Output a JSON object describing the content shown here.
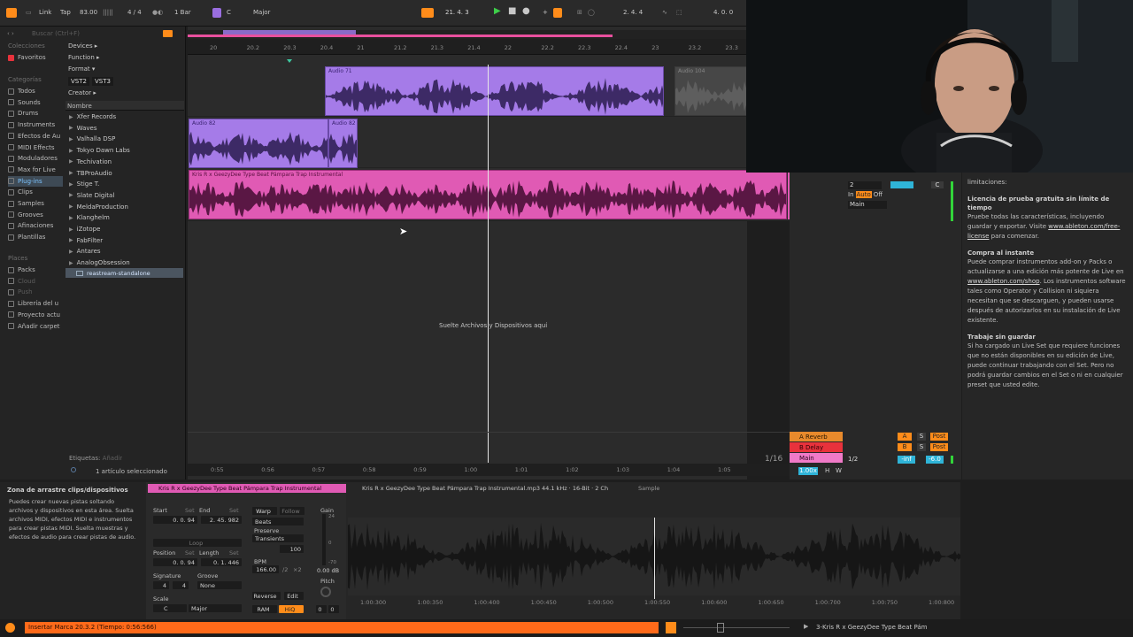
{
  "topbar": {
    "link": "Link",
    "tap": "Tap",
    "tempo": "83.00",
    "signature": "4 / 4",
    "quantize": "1 Bar",
    "key": "C",
    "scale": "Major",
    "position": "21.   4.   3",
    "loop_start": "2.   4.   4",
    "loop_end": "4.   0.   0"
  },
  "browser": {
    "search_placeholder": "Buscar (Ctrl+F)",
    "collections_header": "Colecciones",
    "favorites": "Favoritos",
    "categories_header": "Categorías",
    "categories": [
      "Todos",
      "Sounds",
      "Drums",
      "Instruments",
      "Efectos de Au",
      "MIDI Effects",
      "Moduladores",
      "Max for Live",
      "Plug-ins",
      "Clips",
      "Samples",
      "Grooves",
      "Afinaciones",
      "Plantillas"
    ],
    "places_header": "Places",
    "places": [
      "Packs",
      "Cloud",
      "Push",
      "Librería del u",
      "Proyecto actu",
      "Añadir carpet"
    ],
    "filters": [
      "Devices ▸",
      "Function ▸",
      "Format ▾",
      "Creator ▸"
    ],
    "formats": [
      "VST2",
      "VST3"
    ],
    "column_name": "Nombre",
    "plugins": [
      "Xfer Records",
      "Waves",
      "Valhalla DSP",
      "Tokyo Dawn Labs",
      "Techivation",
      "TBProAudio",
      "Stige T.",
      "Slate Digital",
      "MeldaProduction",
      "Klanghelm",
      "iZotope",
      "FabFilter",
      "Antares",
      "AnalogObsession"
    ],
    "selected_plugin": "reastream-standalone",
    "tags_label": "Etiquetas:",
    "tags_value": "Añadir",
    "selection_count": "1 artículo seleccionado"
  },
  "arrangement": {
    "ruler": [
      "20",
      "20.2",
      "20.3",
      "20.4",
      "21",
      "21.2",
      "21.3",
      "21.4",
      "22",
      "22.2",
      "22.3",
      "22.4",
      "23",
      "23.2",
      "23.3"
    ],
    "time_ruler": [
      "0:55",
      "0:56",
      "0:57",
      "0:58",
      "0:59",
      "1:00",
      "1:01",
      "1:02",
      "1:03",
      "1:04",
      "1:05"
    ],
    "clips": [
      "Audio 71",
      "Audio 104",
      "Audio 82",
      "Audio 82",
      "Kris R x GeezyDee Type Beat  Pámpara  Trap Instrumental"
    ],
    "drop_hint": "Suelte Archivos y Dispositivos aquí",
    "zoom": "1/16"
  },
  "mixer": {
    "returns": [
      "A Reverb",
      "B Delay",
      "Main"
    ],
    "track_in": "2",
    "io": [
      "In",
      "Auto",
      "Off"
    ],
    "output": "Main",
    "sends": [
      "A",
      "B"
    ],
    "post": "Post",
    "solo": "S",
    "fraction": "1/2",
    "vol_a": "-inf",
    "vol_b": "-6.0",
    "speed": "1.00x",
    "h": "H",
    "w": "W"
  },
  "info": {
    "top_text": "limitaciones:",
    "h1": "Licencia de prueba gratuita sin límite de tiempo",
    "p1a": "Pruebe todas las características, incluyendo guardar y exportar. Visite",
    "p1_link": "www.ableton.com/free-license",
    "p1b": "para comenzar.",
    "h2": "Compra al instante",
    "p2a": "Puede comprar instrumentos add-on y Packs o actualizarse a una edición más potente de Live en",
    "p2_link": "www.ableton.com/shop",
    "p2b": ". Los instrumentos software tales como Operator y Collision ni siquiera necesitan que se descarguen, y pueden usarse después de autorizarlos en su instalación de Live existente.",
    "h3": "Trabaje sin guardar",
    "p3": "Si ha cargado un Live Set que requiere funciones que no están disponibles en su edición de Live, puede continuar trabajando con el Set. Pero no podrá guardar cambios en el Set o ni en cualquier preset que usted edite."
  },
  "help": {
    "title": "Zona de arrastre clips/dispositivos",
    "body": "Puedes crear nuevas pistas soltando archivos y dispositivos en esta área. Suelta archivos MIDI, efectos MIDI e instrumentos para crear pistas MIDI. Suelta muestras y efectos de audio para crear pistas de audio."
  },
  "clipview": {
    "name": "Kris R x GeezyDee Type Beat  Pámpara  Trap Instrumental",
    "start": "Start",
    "set": "Set",
    "end": "End",
    "start_val": "0.  0.  94",
    "end_val": "2.  45.  982",
    "loop": "Loop",
    "position": "Position",
    "length": "Length",
    "pos_val": "0.  0.  94",
    "len_val": "0.  1.  446",
    "signature": "Signature",
    "groove": "Groove",
    "sig_num": "4",
    "sig_den": "4",
    "groove_val": "None",
    "scale": "Scale",
    "scale_key": "C",
    "scale_mode": "Major",
    "warp": "Warp",
    "follow": "Follow",
    "warp_mode": "Beats",
    "preserve": "Preserve",
    "preserve_val": "Transients",
    "amount": "100",
    "bpm": "BPM",
    "bpm_val": "166.00",
    "half": "/2",
    "double": "×2",
    "reverse": "Reverse",
    "edit": "Edit",
    "ram": "RAM",
    "hiq": "HiQ",
    "gain": "Gain",
    "gain_val": "0.00 dB",
    "pitch": "Pitch",
    "pitch_val": "0",
    "detune_val": "0",
    "gain_ticks": [
      "24",
      "0",
      "-70"
    ]
  },
  "sampleview": {
    "file_info": "Kris R x GeezyDee Type Beat  Pámpara  Trap Instrumental.mp3  44.1 kHz · 16-Bit · 2 Ch",
    "tab": "Sample",
    "times": [
      "1:00:300",
      "1:00:350",
      "1:00:400",
      "1:00:450",
      "1:00:500",
      "1:00:550",
      "1:00:600",
      "1:00:650",
      "1:00:700",
      "1:00:750",
      "1:00:800"
    ]
  },
  "status": {
    "message": "Insertar Marca 20.3.2 (Tiempo: 0:56:566)",
    "track": "3-Kris R x GeezyDee Type Beat  Pám"
  },
  "colors": {
    "accent_orange": "#ff8c1a",
    "clip_purple": "#b07af0",
    "clip_pink": "#e85ab0",
    "send_red": "#e8323c"
  }
}
